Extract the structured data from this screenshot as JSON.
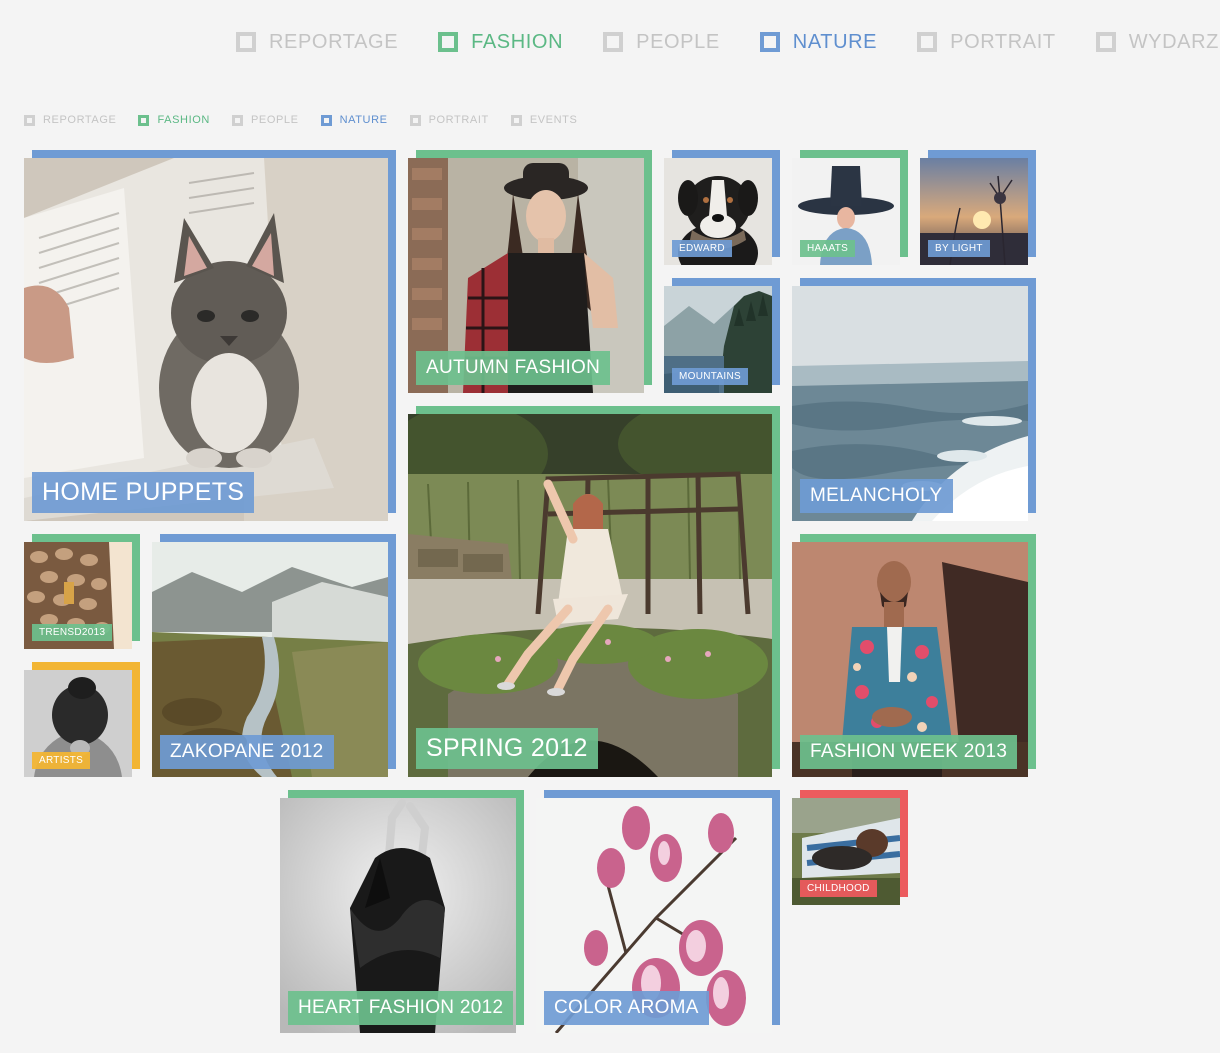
{
  "filters_top": [
    {
      "label": "REPORTAGE",
      "state": "off"
    },
    {
      "label": "FASHION",
      "state": "fashion"
    },
    {
      "label": "PEOPLE",
      "state": "off"
    },
    {
      "label": "NATURE",
      "state": "nature"
    },
    {
      "label": "PORTRAIT",
      "state": "off"
    },
    {
      "label": "WYDARZENIA",
      "state": "off"
    }
  ],
  "filters_bottom": [
    {
      "label": "REPORTAGE",
      "state": "off"
    },
    {
      "label": "FASHION",
      "state": "fashion"
    },
    {
      "label": "PEOPLE",
      "state": "off"
    },
    {
      "label": "NATURE",
      "state": "nature"
    },
    {
      "label": "PORTRAIT",
      "state": "off"
    },
    {
      "label": "EVENTS",
      "state": "off"
    }
  ],
  "colors": {
    "nature": "#6f9bd4",
    "fashion": "#6cc08d",
    "people": "#f2b534",
    "events": "#ec5b5e",
    "inactive": "#d0d0d0"
  },
  "tiles": {
    "home_puppets": {
      "title": "HOME PUPPETS",
      "category": "nature"
    },
    "autumn_fashion": {
      "title": "AUTUMN FASHION",
      "category": "fashion"
    },
    "edward": {
      "title": "EDWARD",
      "category": "nature"
    },
    "haaats": {
      "title": "HAAATS",
      "category": "fashion"
    },
    "by_light": {
      "title": "BY LIGHT",
      "category": "nature"
    },
    "mountains": {
      "title": "MOUNTAINS",
      "category": "nature"
    },
    "melancholy": {
      "title": "MELANCHOLY",
      "category": "nature"
    },
    "spring_2012": {
      "title": "SPRING 2012",
      "category": "fashion"
    },
    "trensd2013": {
      "title": "TRENSD2013",
      "category": "fashion"
    },
    "artists": {
      "title": "ARTISTS",
      "category": "people"
    },
    "zakopane_2012": {
      "title": "ZAKOPANE 2012",
      "category": "nature"
    },
    "fashion_week_2013": {
      "title": "FASHION WEEK 2013",
      "category": "fashion"
    },
    "heart_fashion_2012": {
      "title": "HEART FASHION 2012",
      "category": "fashion"
    },
    "color_aroma": {
      "title": "COLOR AROMA",
      "category": "nature"
    },
    "childhood": {
      "title": "CHILDHOOD",
      "category": "events"
    }
  }
}
